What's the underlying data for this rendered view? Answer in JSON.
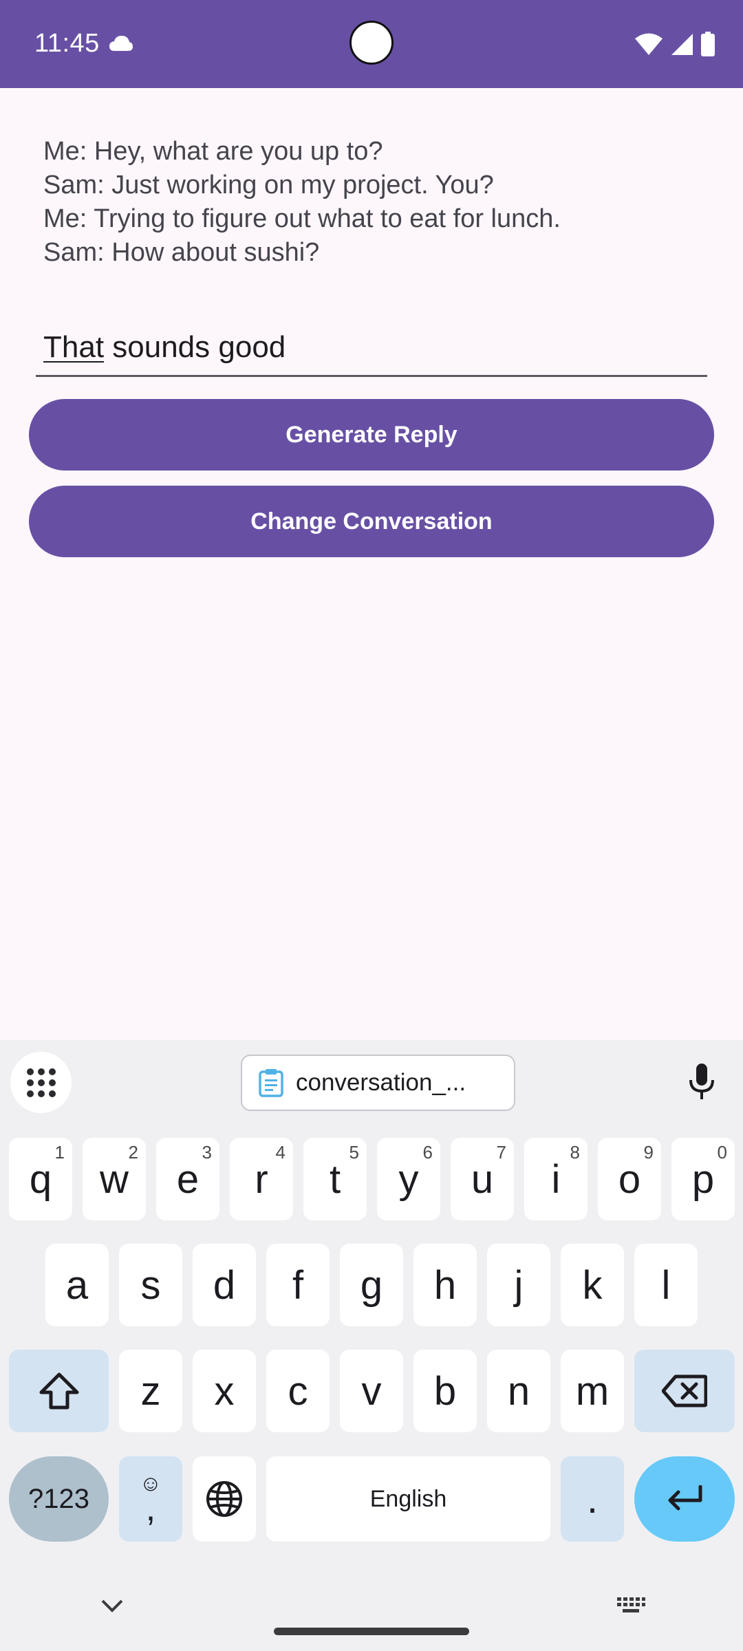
{
  "status_bar": {
    "time": "11:45"
  },
  "conversation": {
    "lines": [
      "Me: Hey, what are you up to?",
      "Sam: Just working on my project. You?",
      "Me: Trying to figure out what to eat for lunch.",
      "Sam: How about sushi?"
    ]
  },
  "reply_input": {
    "underlined_word": "That",
    "rest_text": " sounds good"
  },
  "buttons": {
    "generate": "Generate Reply",
    "change": "Change Conversation"
  },
  "keyboard": {
    "clipboard_chip": "conversation_...",
    "row1": [
      {
        "key": "q",
        "hint": "1"
      },
      {
        "key": "w",
        "hint": "2"
      },
      {
        "key": "e",
        "hint": "3"
      },
      {
        "key": "r",
        "hint": "4"
      },
      {
        "key": "t",
        "hint": "5"
      },
      {
        "key": "y",
        "hint": "6"
      },
      {
        "key": "u",
        "hint": "7"
      },
      {
        "key": "i",
        "hint": "8"
      },
      {
        "key": "o",
        "hint": "9"
      },
      {
        "key": "p",
        "hint": "0"
      }
    ],
    "row2": [
      "a",
      "s",
      "d",
      "f",
      "g",
      "h",
      "j",
      "k",
      "l"
    ],
    "row3": [
      "z",
      "x",
      "c",
      "v",
      "b",
      "n",
      "m"
    ],
    "symbols_key": "?123",
    "emoji_comma_top": "☺",
    "emoji_comma_bottom": ",",
    "space_label": "English",
    "period_key": "."
  },
  "colors": {
    "primary": "#6750a4",
    "background": "#fdf7fc",
    "keyboard_bg": "#f0f0f3",
    "key_accent": "#d3e3f2",
    "enter_key": "#66c9f7"
  }
}
